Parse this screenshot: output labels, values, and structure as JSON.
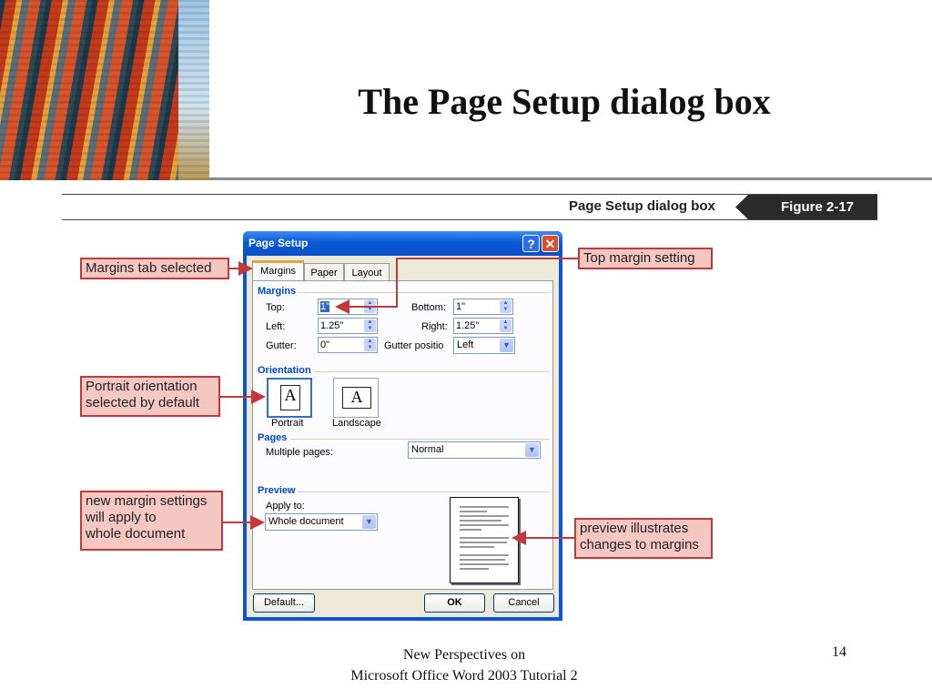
{
  "slide": {
    "title": "The Page Setup dialog box",
    "footer_line1": "New Perspectives on",
    "footer_line2": "Microsoft Office Word 2003 Tutorial 2",
    "page_number": "14"
  },
  "figure": {
    "caption": "Page Setup dialog box",
    "badge": "Figure 2-17",
    "badge_color": "#2b2b2b"
  },
  "dialog": {
    "title": "Page Setup",
    "help_label": "?",
    "close_label": "✕",
    "tabs": [
      {
        "label": "Margins",
        "selected": true
      },
      {
        "label": "Paper",
        "selected": false
      },
      {
        "label": "Layout",
        "selected": false
      }
    ],
    "margins": {
      "header": "Margins",
      "top_label": "Top:",
      "top_value": "1\"",
      "bottom_label": "Bottom:",
      "bottom_value": "1\"",
      "left_label": "Left:",
      "left_value": "1.25\"",
      "right_label": "Right:",
      "right_value": "1.25\"",
      "gutter_label": "Gutter:",
      "gutter_value": "0\"",
      "gutter_pos_label": "Gutter positio",
      "gutter_pos_value": "Left"
    },
    "orientation": {
      "header": "Orientation",
      "portrait_label": "Portrait",
      "landscape_label": "Landscape",
      "selected": "Portrait",
      "glyph": "A"
    },
    "pages": {
      "header": "Pages",
      "multiple_label": "Multiple pages:",
      "multiple_value": "Normal"
    },
    "preview": {
      "header": "Preview",
      "apply_label": "Apply to:",
      "apply_value": "Whole document"
    },
    "buttons": {
      "default": "Default...",
      "ok": "OK",
      "cancel": "Cancel"
    }
  },
  "callouts": {
    "margins_tab": "Margins tab selected",
    "top_margin": "Top margin setting",
    "portrait_1": "Portrait orientation",
    "portrait_2": "selected by default",
    "apply_1": "new margin settings",
    "apply_2": "will apply to",
    "apply_3": "whole document",
    "preview_1": "preview illustrates",
    "preview_2": "changes to margins"
  },
  "colors": {
    "callout_fill": "#f4c7c3",
    "callout_border": "#c0393b",
    "title_bar": "#0a5ad7"
  }
}
